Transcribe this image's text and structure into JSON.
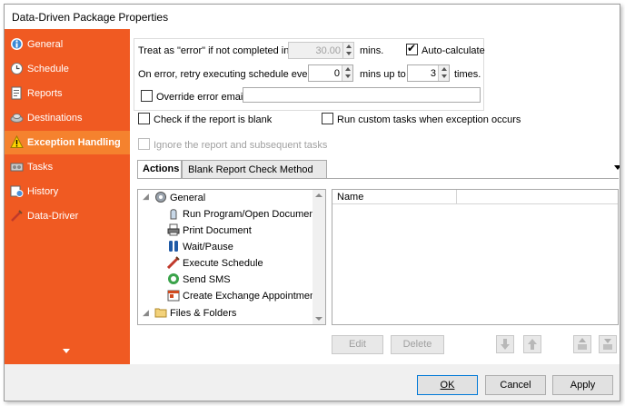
{
  "window": {
    "title": "Data-Driven Package Properties"
  },
  "sidebar": {
    "items": [
      {
        "label": "General",
        "icon": "info-icon"
      },
      {
        "label": "Schedule",
        "icon": "clock-icon"
      },
      {
        "label": "Reports",
        "icon": "report-icon"
      },
      {
        "label": "Destinations",
        "icon": "destinations-icon"
      },
      {
        "label": "Exception Handling",
        "icon": "warning-icon",
        "active": true
      },
      {
        "label": "Tasks",
        "icon": "tasks-icon"
      },
      {
        "label": "History",
        "icon": "history-icon"
      },
      {
        "label": "Data-Driver",
        "icon": "data-driver-icon"
      }
    ]
  },
  "exception": {
    "treat_label": "Treat as \"error\" if not completed in",
    "treat_value": "30.00",
    "treat_unit": "mins.",
    "autocalc_label": "Auto-calculate",
    "autocalc_checked": true,
    "retry_label": "On error, retry  executing schedule every",
    "retry_value": "0",
    "retry_mid": "mins up to",
    "retry_times_value": "3",
    "retry_times_label": "times.",
    "override_label": "Override error email:",
    "override_value": "",
    "check_blank_label": "Check if the report is blank",
    "custom_tasks_label": "Run custom tasks when exception occurs",
    "ignore_label": "Ignore the report and subsequent tasks"
  },
  "tabs": [
    {
      "label": "Actions",
      "active": true
    },
    {
      "label": "Blank Report Check Method",
      "active": false
    }
  ],
  "tree": {
    "groups": [
      {
        "label": "General",
        "icon": "gear-icon",
        "children": [
          {
            "label": "Run Program/Open Document",
            "icon": "run-program-icon"
          },
          {
            "label": "Print Document",
            "icon": "printer-icon"
          },
          {
            "label": "Wait/Pause",
            "icon": "pause-icon"
          },
          {
            "label": "Execute Schedule",
            "icon": "execute-schedule-icon"
          },
          {
            "label": "Send SMS",
            "icon": "sms-icon"
          },
          {
            "label": "Create Exchange Appointment",
            "icon": "appointment-icon"
          }
        ]
      },
      {
        "label": "Files & Folders",
        "icon": "folder-icon",
        "children": []
      }
    ]
  },
  "list": {
    "columns": [
      "Name",
      ""
    ]
  },
  "actions": {
    "edit_label": "Edit",
    "delete_label": "Delete"
  },
  "footer": {
    "ok_label": "OK",
    "cancel_label": "Cancel",
    "apply_label": "Apply"
  },
  "colors": {
    "sidebar": "#f05a22",
    "sidebar_active": "#f5822e",
    "primary_border": "#0078d7"
  }
}
